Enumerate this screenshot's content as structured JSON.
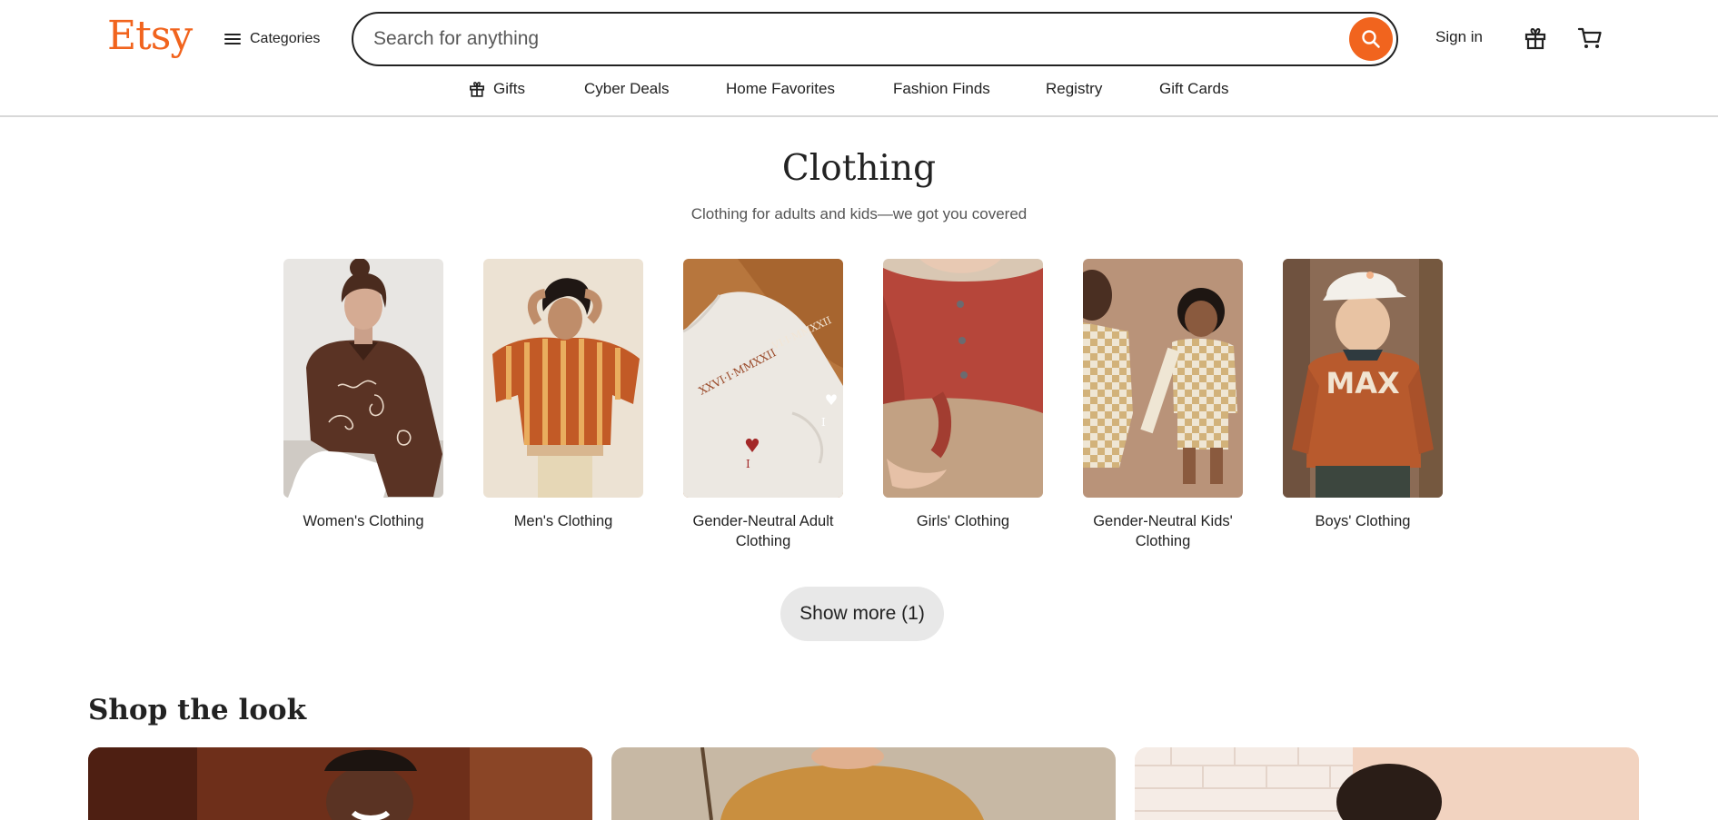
{
  "header": {
    "logo": "Etsy",
    "categories_label": "Categories",
    "search_placeholder": "Search for anything",
    "sign_in": "Sign in"
  },
  "subnav": [
    {
      "label": "Gifts",
      "icon": "gift-icon"
    },
    {
      "label": "Cyber Deals"
    },
    {
      "label": "Home Favorites"
    },
    {
      "label": "Fashion Finds"
    },
    {
      "label": "Registry"
    },
    {
      "label": "Gift Cards"
    }
  ],
  "main": {
    "title": "Clothing",
    "subtitle": "Clothing for adults and kids—we got you covered",
    "categories": [
      {
        "label": "Women's Clothing"
      },
      {
        "label": "Men's Clothing"
      },
      {
        "label": "Gender-Neutral Adult Clothing"
      },
      {
        "label": "Girls' Clothing"
      },
      {
        "label": "Gender-Neutral Kids' Clothing"
      },
      {
        "label": "Boys' Clothing"
      }
    ],
    "show_more": "Show more (1)",
    "shop_the_look": "Shop the look",
    "category_image_text": {
      "gender_neutral_adult_1": "XXVI·I·MMXXII",
      "gender_neutral_adult_2": "VI·I·MMXXII",
      "boys_sweater": "MAX"
    }
  },
  "colors": {
    "brand": "#f1641e",
    "text": "#222222",
    "button_bg": "#e8e8e8"
  }
}
